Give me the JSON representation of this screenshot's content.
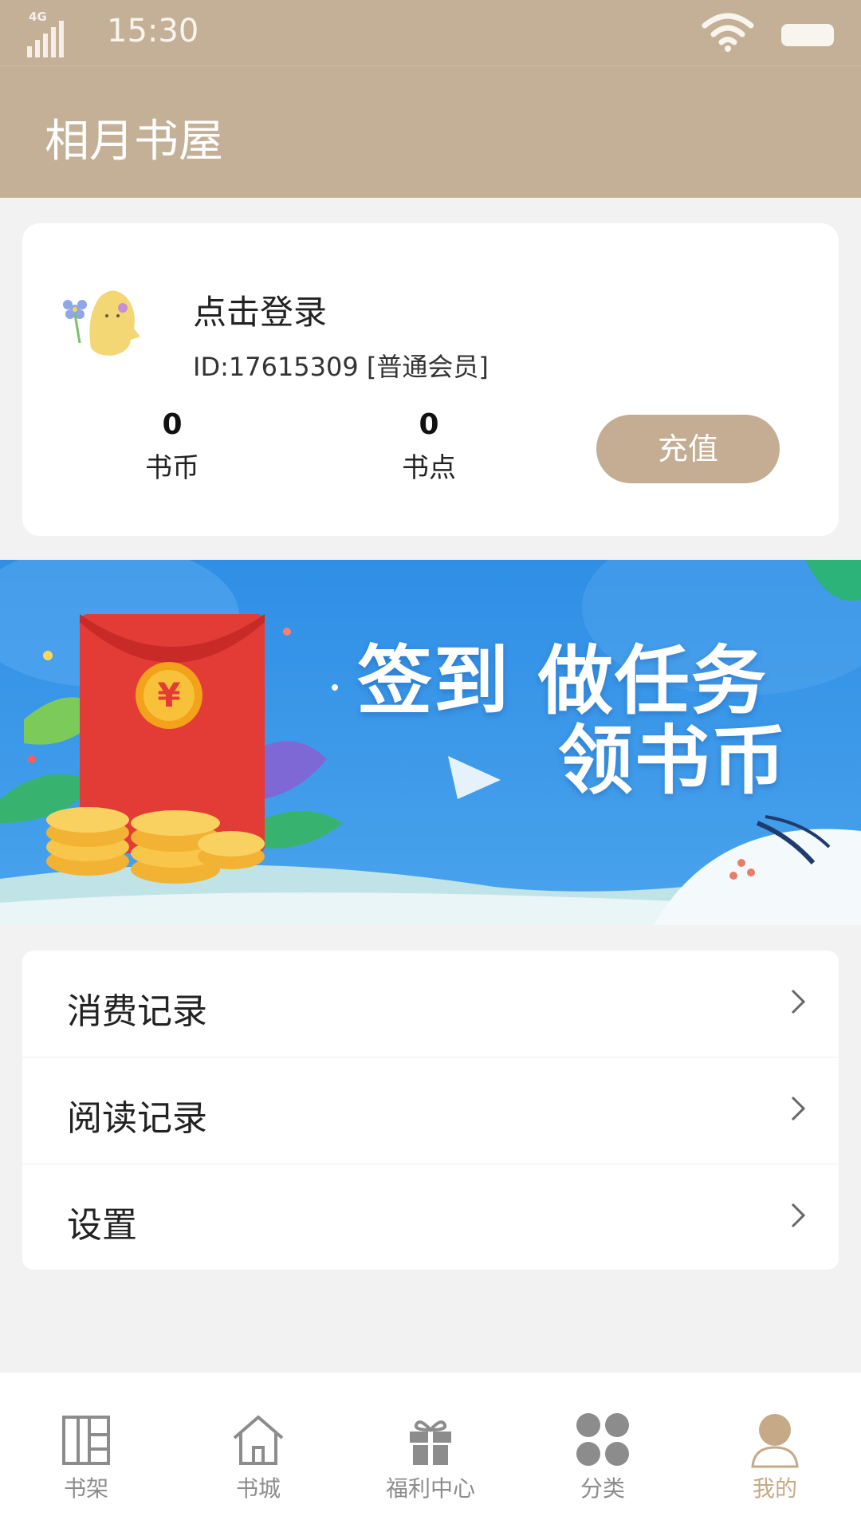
{
  "status_bar": {
    "network": "4G",
    "time": "15:30"
  },
  "header": {
    "title": "相月书屋"
  },
  "profile": {
    "login_text": "点击登录",
    "user_id": "ID:17615309",
    "member_level": "[普通会员]",
    "stats": [
      {
        "value": "0",
        "label": "书币"
      },
      {
        "value": "0",
        "label": "书点"
      }
    ],
    "recharge_label": "充值"
  },
  "banner": {
    "line1": "签到 做任务",
    "line2": "领书币",
    "coin_symbol": "¥"
  },
  "menu": {
    "items": [
      {
        "label": "消费记录"
      },
      {
        "label": "阅读记录"
      },
      {
        "label": "设置"
      }
    ]
  },
  "tabbar": {
    "active": "我的",
    "items": [
      {
        "label": "书架",
        "icon": "bookshelf-icon"
      },
      {
        "label": "书城",
        "icon": "home-icon"
      },
      {
        "label": "福利中心",
        "icon": "gift-icon"
      },
      {
        "label": "分类",
        "icon": "category-icon"
      },
      {
        "label": "我的",
        "icon": "profile-icon"
      }
    ]
  },
  "colors": {
    "header": "#c4b097",
    "accent": "#c4ad92",
    "banner_blue": "#3d95e2",
    "page_bg": "#f2f2f2"
  }
}
